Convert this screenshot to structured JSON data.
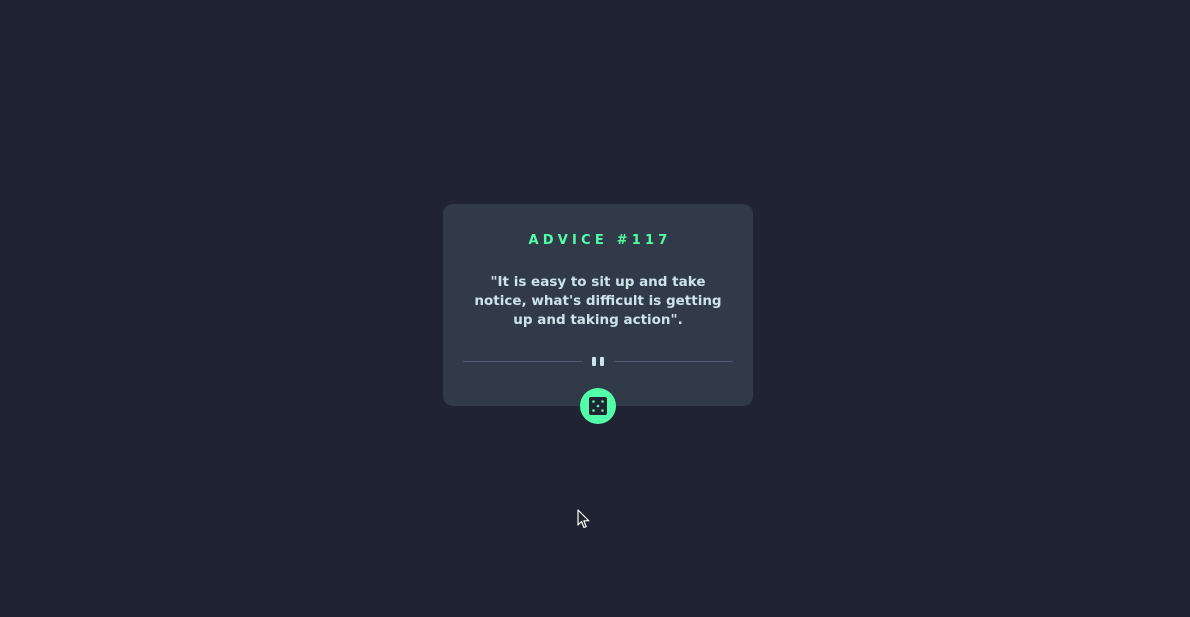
{
  "card": {
    "advice_id": "ADVICE #117",
    "advice_text": "\"It is easy to sit up and take notice, what's difficult is getting up and taking action\"."
  },
  "icons": {
    "divider": "pause-icon",
    "dice": "dice-icon",
    "cursor": "mouse-pointer-icon"
  },
  "colors": {
    "background": "#202432",
    "card": "#313A49",
    "accent": "#52FFA8",
    "text": "#CEE3E9",
    "divider_line": "#4F5D74"
  }
}
